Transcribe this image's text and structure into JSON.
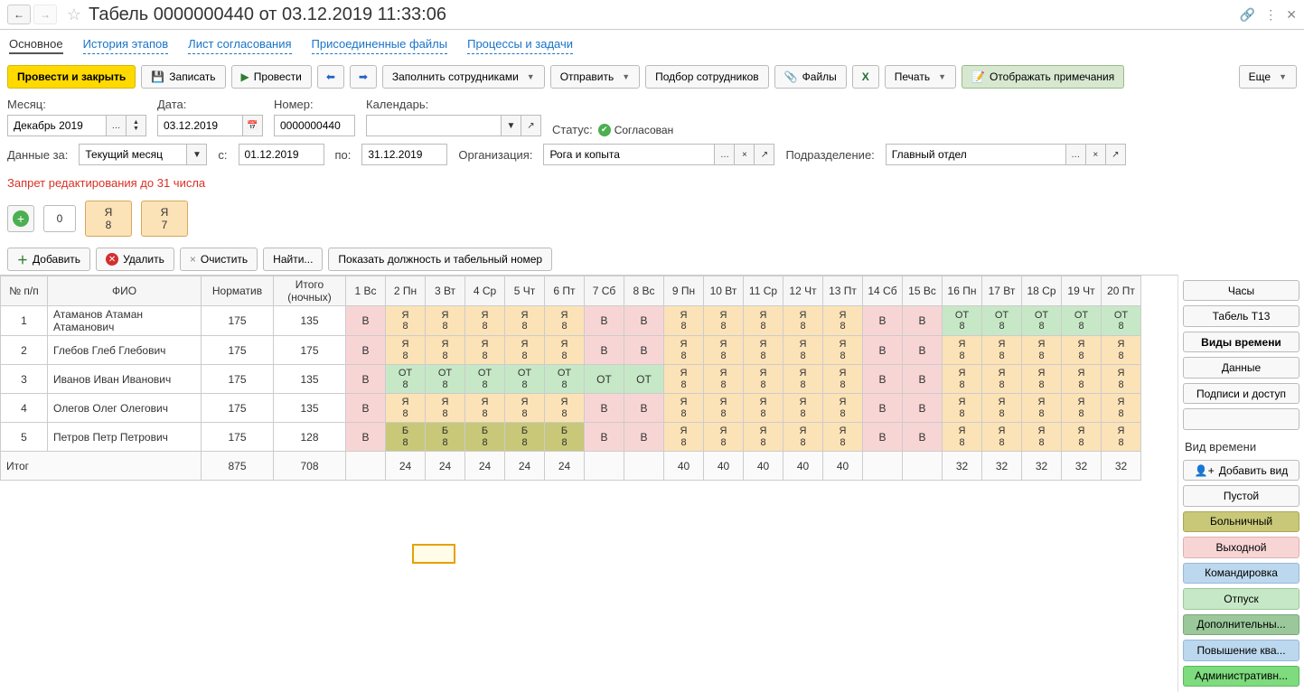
{
  "title": "Табель 0000000440 от 03.12.2019 11:33:06",
  "tabs": [
    "Основное",
    "История этапов",
    "Лист согласования",
    "Присоединенные файлы",
    "Процессы и задачи"
  ],
  "toolbar": {
    "post_close": "Провести и закрыть",
    "save": "Записать",
    "post": "Провести",
    "fill": "Заполнить сотрудниками",
    "send": "Отправить",
    "pick": "Подбор сотрудников",
    "files": "Файлы",
    "print": "Печать",
    "notes": "Отображать примечания",
    "more": "Еще"
  },
  "form": {
    "month_lbl": "Месяц:",
    "month": "Декабрь 2019",
    "date_lbl": "Дата:",
    "date": "03.12.2019",
    "num_lbl": "Номер:",
    "num": "0000000440",
    "cal_lbl": "Календарь:",
    "cal": "",
    "status_lbl": "Статус:",
    "status": "Согласован",
    "data_lbl": "Данные за:",
    "data": "Текущий месяц",
    "from_lbl": "с:",
    "from": "01.12.2019",
    "to_lbl": "по:",
    "to": "31.12.2019",
    "org_lbl": "Организация:",
    "org": "Рога и копыта",
    "dept_lbl": "Подразделение:",
    "dept": "Главный отдел",
    "lock_msg": "Запрет редактирования до 31 числа"
  },
  "countrow": {
    "zero": "0",
    "chip_code": "Я",
    "chip1": "8",
    "chip2": "7"
  },
  "toolbar2": {
    "add": "Добавить",
    "del": "Удалить",
    "clear": "Очистить",
    "find": "Найти...",
    "show": "Показать должность и табельный номер"
  },
  "headers": {
    "num": "№ п/п",
    "fio": "ФИО",
    "norm": "Норматив",
    "total": "Итого (ночных)",
    "days": [
      "1 Вс",
      "2 Пн",
      "3 Вт",
      "4 Ср",
      "5 Чт",
      "6 Пт",
      "7 Сб",
      "8 Вс",
      "9 Пн",
      "10 Вт",
      "11 Ср",
      "12 Чт",
      "13 Пт",
      "14 Сб",
      "15 Вс",
      "16 Пн",
      "17 Вт",
      "18 Ср",
      "19 Чт",
      "20 Пт"
    ]
  },
  "rows": [
    {
      "n": "1",
      "name": "Атаманов Атаман Атаманович",
      "norm": "175",
      "tot": "135",
      "cells": [
        [
          "В",
          "V"
        ],
        [
          "Я 8",
          "YA"
        ],
        [
          "Я 8",
          "YA"
        ],
        [
          "Я 8",
          "YA"
        ],
        [
          "Я 8",
          "YA"
        ],
        [
          "Я 8",
          "YA"
        ],
        [
          "В",
          "V"
        ],
        [
          "В",
          "V"
        ],
        [
          "Я 8",
          "YA"
        ],
        [
          "Я 8",
          "YA"
        ],
        [
          "Я 8",
          "YA"
        ],
        [
          "Я 8",
          "YA"
        ],
        [
          "Я 8",
          "YA"
        ],
        [
          "В",
          "V"
        ],
        [
          "В",
          "V"
        ],
        [
          "ОТ 8",
          "OT"
        ],
        [
          "ОТ 8",
          "OT"
        ],
        [
          "ОТ 8",
          "OT"
        ],
        [
          "ОТ 8",
          "OT"
        ],
        [
          "ОТ 8",
          "OT"
        ]
      ]
    },
    {
      "n": "2",
      "name": "Глебов Глеб Глебович",
      "norm": "175",
      "tot": "175",
      "cells": [
        [
          "В",
          "V"
        ],
        [
          "Я 8",
          "YA"
        ],
        [
          "Я 8",
          "YA"
        ],
        [
          "Я 8",
          "YA"
        ],
        [
          "Я 8",
          "YA"
        ],
        [
          "Я 8",
          "YA"
        ],
        [
          "В",
          "V"
        ],
        [
          "В",
          "V"
        ],
        [
          "Я 8",
          "YA"
        ],
        [
          "Я 8",
          "YA"
        ],
        [
          "Я 8",
          "YA"
        ],
        [
          "Я 8",
          "YA"
        ],
        [
          "Я 8",
          "YA"
        ],
        [
          "В",
          "V"
        ],
        [
          "В",
          "V"
        ],
        [
          "Я 8",
          "YA"
        ],
        [
          "Я 8",
          "YA"
        ],
        [
          "Я 8",
          "YA"
        ],
        [
          "Я 8",
          "YA"
        ],
        [
          "Я 8",
          "YA"
        ]
      ]
    },
    {
      "n": "3",
      "name": "Иванов Иван Иванович",
      "norm": "175",
      "tot": "135",
      "cells": [
        [
          "В",
          "V"
        ],
        [
          "ОТ 8",
          "OT"
        ],
        [
          "ОТ 8",
          "OT"
        ],
        [
          "ОТ 8",
          "OT"
        ],
        [
          "ОТ 8",
          "OT"
        ],
        [
          "ОТ 8",
          "OT"
        ],
        [
          "ОТ",
          "OT"
        ],
        [
          "ОТ",
          "OT"
        ],
        [
          "Я 8",
          "YA"
        ],
        [
          "Я 8",
          "YA"
        ],
        [
          "Я 8",
          "YA"
        ],
        [
          "Я 8",
          "YA"
        ],
        [
          "Я 8",
          "YA"
        ],
        [
          "В",
          "V"
        ],
        [
          "В",
          "V"
        ],
        [
          "Я 8",
          "YA"
        ],
        [
          "Я 8",
          "YA"
        ],
        [
          "Я 8",
          "YA"
        ],
        [
          "Я 8",
          "YA"
        ],
        [
          "Я 8",
          "YA"
        ]
      ]
    },
    {
      "n": "4",
      "name": "Олегов Олег Олегович",
      "norm": "175",
      "tot": "135",
      "cells": [
        [
          "В",
          "V"
        ],
        [
          "Я 8",
          "YA"
        ],
        [
          "Я 8",
          "YA"
        ],
        [
          "Я 8",
          "YA"
        ],
        [
          "Я 8",
          "YA"
        ],
        [
          "Я 8",
          "YA"
        ],
        [
          "В",
          "V"
        ],
        [
          "В",
          "V"
        ],
        [
          "Я 8",
          "YA"
        ],
        [
          "Я 8",
          "YA"
        ],
        [
          "Я 8",
          "YA"
        ],
        [
          "Я 8",
          "YA"
        ],
        [
          "Я 8",
          "YA"
        ],
        [
          "В",
          "V"
        ],
        [
          "В",
          "V"
        ],
        [
          "Я 8",
          "YA"
        ],
        [
          "Я 8",
          "YA"
        ],
        [
          "Я 8",
          "YA"
        ],
        [
          "Я 8",
          "YA"
        ],
        [
          "Я 8",
          "YA"
        ]
      ]
    },
    {
      "n": "5",
      "name": "Петров Петр Петрович",
      "norm": "175",
      "tot": "128",
      "cells": [
        [
          "В",
          "V"
        ],
        [
          "Б 8",
          "B"
        ],
        [
          "Б 8",
          "B"
        ],
        [
          "Б 8",
          "B"
        ],
        [
          "Б 8",
          "B"
        ],
        [
          "Б 8",
          "B"
        ],
        [
          "В",
          "V"
        ],
        [
          "В",
          "V"
        ],
        [
          "Я 8",
          "YA"
        ],
        [
          "Я 8",
          "YA"
        ],
        [
          "Я 8",
          "YA"
        ],
        [
          "Я 8",
          "YA"
        ],
        [
          "Я 8",
          "YA"
        ],
        [
          "В",
          "V"
        ],
        [
          "В",
          "V"
        ],
        [
          "Я 8",
          "YA"
        ],
        [
          "Я 8",
          "YA"
        ],
        [
          "Я 8",
          "YA"
        ],
        [
          "Я 8",
          "YA"
        ],
        [
          "Я 8",
          "YA"
        ]
      ]
    }
  ],
  "totals": {
    "label": "Итог",
    "norm": "875",
    "tot": "708",
    "cells": [
      "",
      "24",
      "24",
      "24",
      "24",
      "24",
      "",
      "",
      "40",
      "40",
      "40",
      "40",
      "40",
      "",
      "",
      "32",
      "32",
      "32",
      "32",
      "32"
    ]
  },
  "side": {
    "hours": "Часы",
    "t13": "Табель Т13",
    "timetypes": "Виды времени",
    "data": "Данные",
    "sign": "Подписи и доступ",
    "tt_head": "Вид времени",
    "addtype": "Добавить вид",
    "empty": "Пустой",
    "sick": "Больничный",
    "holiday": "Выходной",
    "trip": "Командировка",
    "vac": "Отпуск",
    "extra": "Дополнительны...",
    "upskill": "Повышение ква...",
    "admin": "Административн..."
  }
}
